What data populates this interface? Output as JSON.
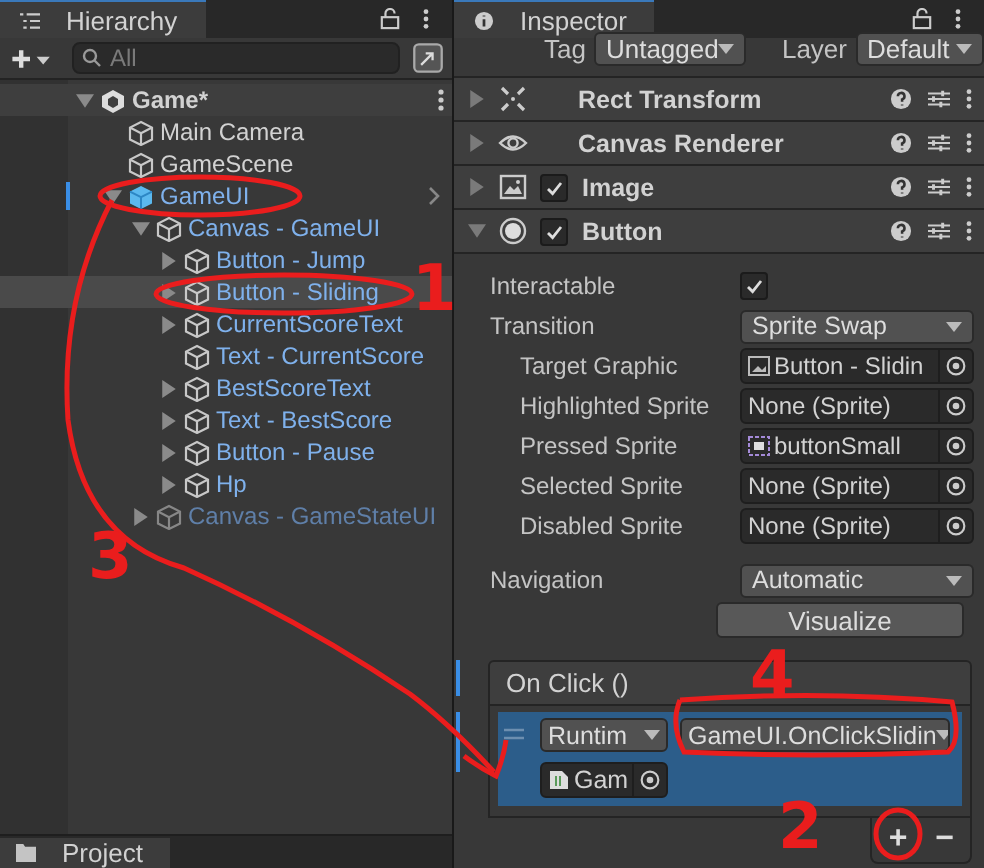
{
  "hierarchy": {
    "title": "Hierarchy",
    "search": {
      "placeholder": "All"
    },
    "items": [
      {
        "label": "Game*",
        "kind": "scene",
        "expanded": true,
        "selected": false,
        "children": [
          {
            "label": "Main Camera",
            "kind": "object",
            "selected": false
          },
          {
            "label": "GameScene",
            "kind": "object",
            "selected": false
          },
          {
            "label": "GameUI",
            "kind": "prefab-root",
            "expanded": true,
            "selected": false,
            "children": [
              {
                "label": "Canvas - GameUI",
                "kind": "prefab",
                "expanded": true,
                "selected": false,
                "children": [
                  {
                    "label": "Button - Jump",
                    "kind": "prefab",
                    "expanded": false,
                    "selected": false
                  },
                  {
                    "label": "Button - Sliding",
                    "kind": "prefab",
                    "expanded": false,
                    "selected": true
                  },
                  {
                    "label": "CurrentScoreText",
                    "kind": "prefab",
                    "expanded": false,
                    "selected": false
                  },
                  {
                    "label": "Text - CurrentScore",
                    "kind": "prefab",
                    "selected": false
                  },
                  {
                    "label": "BestScoreText",
                    "kind": "prefab",
                    "expanded": false,
                    "selected": false
                  },
                  {
                    "label": "Text - BestScore",
                    "kind": "prefab",
                    "expanded": false,
                    "selected": false
                  },
                  {
                    "label": "Button - Pause",
                    "kind": "prefab",
                    "expanded": false,
                    "selected": false
                  },
                  {
                    "label": "Hp",
                    "kind": "prefab",
                    "expanded": false,
                    "selected": false
                  }
                ]
              },
              {
                "label": "Canvas - GameStateUI",
                "kind": "prefab",
                "expanded": false,
                "active": false,
                "selected": false
              }
            ]
          }
        ]
      }
    ]
  },
  "project_tab": {
    "title": "Project"
  },
  "inspector": {
    "title": "Inspector",
    "tag": {
      "label": "Tag",
      "value": "Untagged"
    },
    "layer": {
      "label": "Layer",
      "value": "Default"
    },
    "components": [
      {
        "name": "Rect Transform",
        "kind": "transform",
        "expanded": false
      },
      {
        "name": "Canvas Renderer",
        "kind": "renderer",
        "expanded": false
      },
      {
        "name": "Image",
        "kind": "image",
        "expanded": false,
        "enabled": true
      },
      {
        "name": "Button",
        "kind": "button",
        "expanded": true,
        "enabled": true
      }
    ],
    "properties": [
      {
        "label": "Interactable",
        "kind": "checkbox",
        "checked": true
      },
      {
        "label": "Transition",
        "kind": "dropdown",
        "value": "Sprite Swap",
        "children": [
          {
            "label": "Target Graphic",
            "kind": "object-image",
            "value": "Button - Slidin"
          },
          {
            "label": "Highlighted Sprite",
            "kind": "object",
            "value": "None (Sprite)"
          },
          {
            "label": "Pressed Sprite",
            "kind": "object-sprite",
            "value": "buttonSmall"
          },
          {
            "label": "Selected Sprite",
            "kind": "object",
            "value": "None (Sprite)"
          },
          {
            "label": "Disabled Sprite",
            "kind": "object",
            "value": "None (Sprite)"
          }
        ]
      },
      {
        "label": "Navigation",
        "kind": "dropdown",
        "value": "Automatic"
      }
    ],
    "visualize_button": "Visualize",
    "on_click": {
      "title": "On Click ()",
      "entries": [
        {
          "runtime": "Runtim",
          "function": "GameUI.OnClickSlidin",
          "object": "Gam"
        }
      ],
      "add_button": "+",
      "remove_button": "−"
    }
  },
  "annotations": [
    {
      "text": "1"
    },
    {
      "text": "2"
    },
    {
      "text": "3"
    },
    {
      "text": "4"
    }
  ]
}
